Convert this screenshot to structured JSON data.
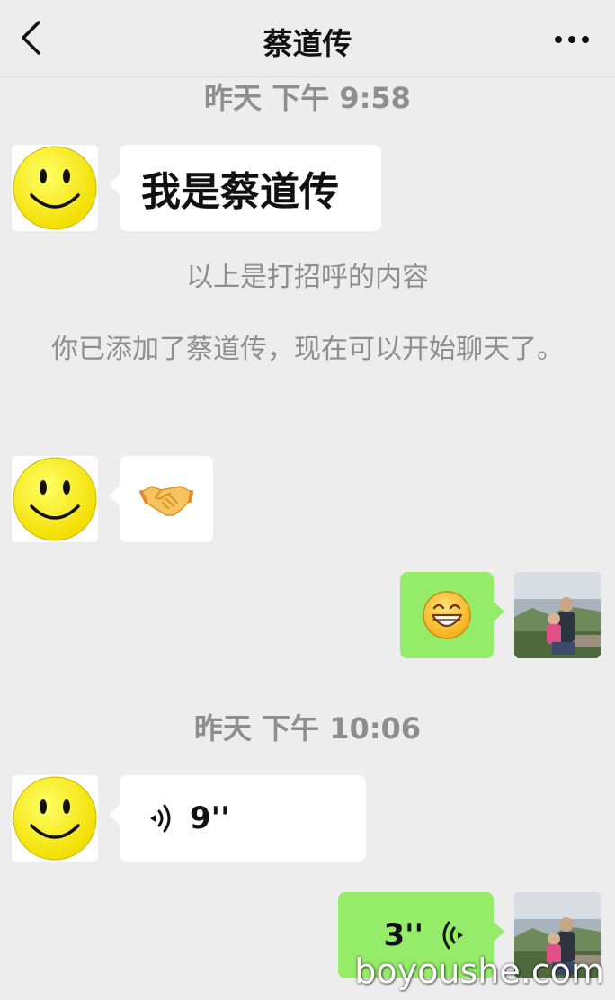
{
  "header": {
    "title": "蔡道传",
    "back_icon": "chevron-left-icon",
    "more_icon": "more-dots-icon"
  },
  "messages": {
    "ts1": "昨天 下午 9:58",
    "m1_text": "我是蔡道传",
    "sys1": "以上是打招呼的内容",
    "sys2": "你已添加了蔡道传，现在可以开始聊天了。",
    "m2_emoji": "handshake",
    "m3_emoji": "grinning-face",
    "ts2": "昨天 下午 10:06",
    "m4_duration": "9''",
    "m5_duration": "3''"
  },
  "colors": {
    "bubble_green": "#95ec69",
    "bubble_white": "#ffffff",
    "background": "#ededed",
    "meta_gray": "#8e8e8e"
  },
  "watermark": "boyoushe.com"
}
